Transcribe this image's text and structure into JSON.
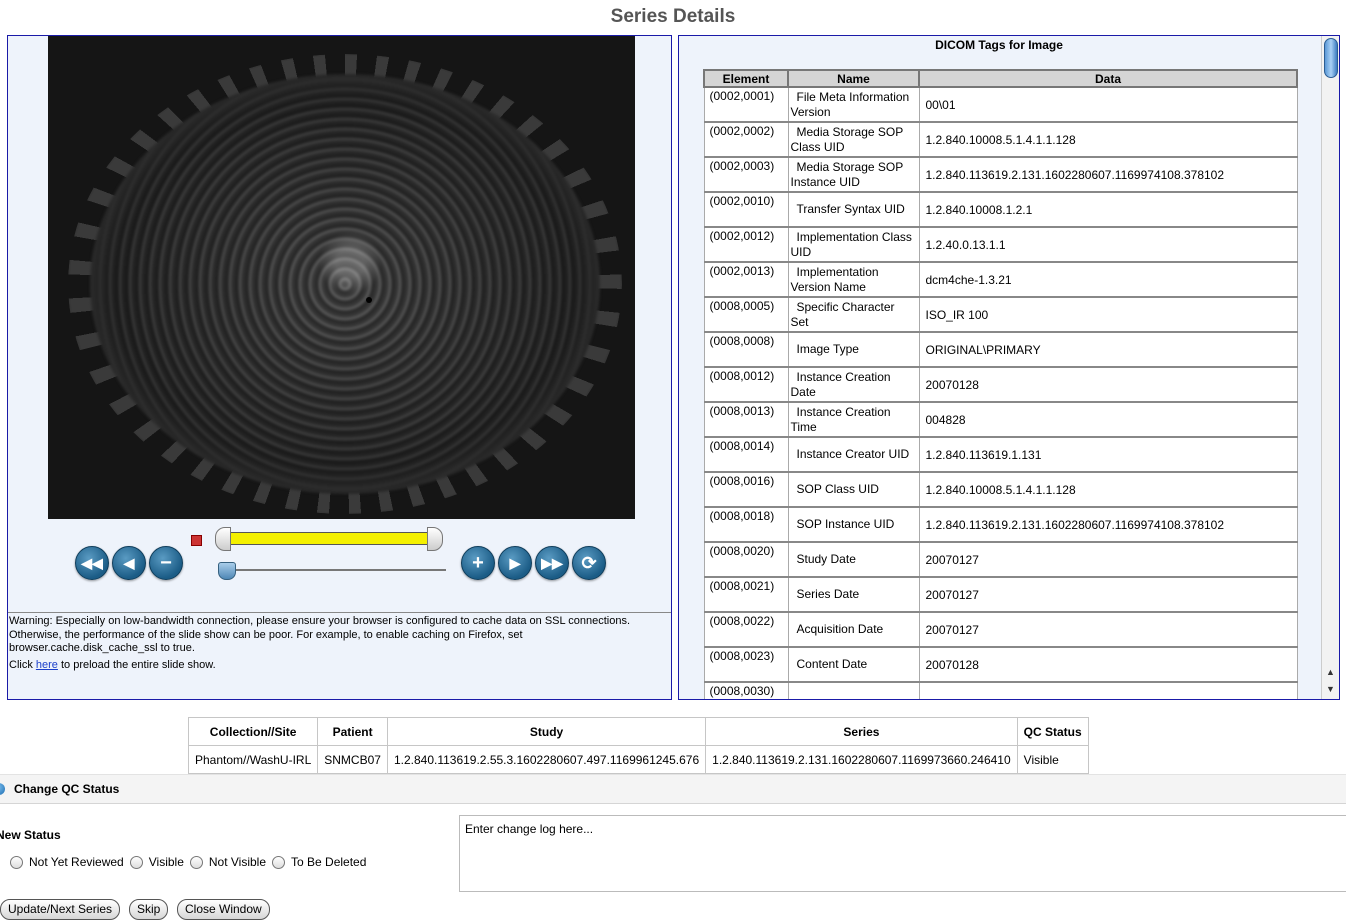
{
  "page_title": "Series Details",
  "viewer": {
    "controls": {
      "first": "first-icon",
      "previous": "previous-icon",
      "zoom_out": "minus-icon",
      "zoom_in": "plus-icon",
      "next": "next-icon",
      "last": "last-icon",
      "refresh": "refresh-icon"
    },
    "warning_text": "Warning: Especially on low-bandwidth connection, please ensure your browser is configured to cache data on SSL connections. Otherwise, the performance of the slide show can be poor. For example, to enable caching on Firefox, set browser.cache.disk_cache_ssl to true.",
    "preload_prefix": "Click ",
    "preload_link": "here",
    "preload_suffix": " to preload the entire slide show."
  },
  "dicom": {
    "title": "DICOM Tags for Image",
    "headers": {
      "element": "Element",
      "name": "Name",
      "data": "Data"
    },
    "rows": [
      {
        "element": "(0002,0001)",
        "name": "File Meta Information Version",
        "data": "00\\01"
      },
      {
        "element": "(0002,0002)",
        "name": "Media Storage SOP Class UID",
        "data": "1.2.840.10008.5.1.4.1.1.128"
      },
      {
        "element": "(0002,0003)",
        "name": "Media Storage SOP Instance UID",
        "data": "1.2.840.113619.2.131.1602280607.1169974108.378102"
      },
      {
        "element": "(0002,0010)",
        "name": "Transfer Syntax UID",
        "data": "1.2.840.10008.1.2.1"
      },
      {
        "element": "(0002,0012)",
        "name": "Implementation Class UID",
        "data": "1.2.40.0.13.1.1"
      },
      {
        "element": "(0002,0013)",
        "name": "Implementation Version Name",
        "data": "dcm4che-1.3.21"
      },
      {
        "element": "(0008,0005)",
        "name": "Specific Character Set",
        "data": "ISO_IR 100"
      },
      {
        "element": "(0008,0008)",
        "name": "Image Type",
        "data": "ORIGINAL\\PRIMARY"
      },
      {
        "element": "(0008,0012)",
        "name": "Instance Creation Date",
        "data": "20070128"
      },
      {
        "element": "(0008,0013)",
        "name": "Instance Creation Time",
        "data": "004828"
      },
      {
        "element": "(0008,0014)",
        "name": "Instance Creator UID",
        "data": "1.2.840.113619.1.131"
      },
      {
        "element": "(0008,0016)",
        "name": "SOP Class UID",
        "data": "1.2.840.10008.5.1.4.1.1.128"
      },
      {
        "element": "(0008,0018)",
        "name": "SOP Instance UID",
        "data": "1.2.840.113619.2.131.1602280607.1169974108.378102"
      },
      {
        "element": "(0008,0020)",
        "name": "Study Date",
        "data": "20070127"
      },
      {
        "element": "(0008,0021)",
        "name": "Series Date",
        "data": "20070127"
      },
      {
        "element": "(0008,0022)",
        "name": "Acquisition Date",
        "data": "20070127"
      },
      {
        "element": "(0008,0023)",
        "name": "Content Date",
        "data": "20070128"
      },
      {
        "element": "(0008,0030)",
        "name": "",
        "data": ""
      }
    ]
  },
  "summary": {
    "headers": [
      "Collection//Site",
      "Patient",
      "Study",
      "Series",
      "QC Status"
    ],
    "row": [
      "Phantom//WashU-IRL",
      "SNMCB07",
      "1.2.840.113619.2.55.3.1602280607.497.1169961245.676",
      "1.2.840.113619.2.131.1602280607.1169973660.246410",
      "Visible"
    ]
  },
  "qc": {
    "section_title": "Change QC Status",
    "new_status_label": "New Status",
    "options": [
      "Not Yet Reviewed",
      "Visible",
      "Not Visible",
      "To Be Deleted"
    ],
    "change_log_placeholder": "Enter change log here...",
    "buttons": {
      "update": "Update/Next Series",
      "skip": "Skip",
      "close": "Close Window"
    }
  }
}
